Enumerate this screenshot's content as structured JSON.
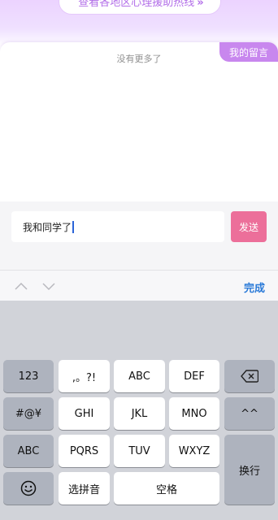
{
  "top": {
    "hotline_label": "查看各地区心理援助热线",
    "hotline_chevron": "»"
  },
  "panel": {
    "my_messages_tab": "我的留言",
    "no_more_text": "没有更多了"
  },
  "composer": {
    "input_value": "我和同学了",
    "send_label": "发送"
  },
  "accessory": {
    "done_label": "完成"
  },
  "keyboard": {
    "row1": [
      "123",
      ",。?!",
      "ABC",
      "DEF"
    ],
    "row2": [
      "#@¥",
      "GHI",
      "JKL",
      "MNO",
      "^^"
    ],
    "row3": [
      "ABC",
      "PQRS",
      "TUV",
      "WXYZ"
    ],
    "row4": [
      "选拼音",
      "空格"
    ],
    "return_label": "换行"
  },
  "colors": {
    "accent_purple": "#c887ee",
    "send_pink": "#ec6f9a",
    "done_blue": "#2a7ad8"
  }
}
